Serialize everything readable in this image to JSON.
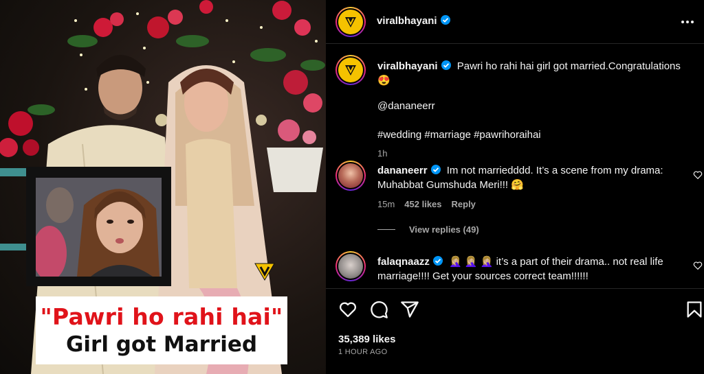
{
  "post": {
    "image_caption_line1": "\"Pawri ho rahi hai\"",
    "image_caption_line2": "Girl got Married"
  },
  "header": {
    "username": "viralbhayani",
    "more_icon": "more-horizontal-icon"
  },
  "caption": {
    "username": "viralbhayani",
    "text": "Pawri ho rahi hai girl got married.Congratulations 😍",
    "mention": "@dananeerr",
    "hashtags": "#wedding #marriage #pawrihoraihai",
    "time": "1h"
  },
  "comments": [
    {
      "username": "dananeerr",
      "text_line1": "Im not marriedddd. It’s a scene from my drama:",
      "text_line2": "Muhabbat Gumshuda Meri!!! 🤗",
      "time": "15m",
      "likes": "452 likes",
      "reply": "Reply",
      "view_replies": "View replies (49)"
    },
    {
      "username": "falaqnaazz",
      "text_line1": "🤦🏼‍♀️ 🤦🏼‍♀️ 🤦🏼‍♀️  it’s a part of their drama.. not real life",
      "text_line2": "marriage!!!! Get your sources correct team!!!!!!"
    }
  ],
  "actions": {
    "like_icon": "heart-icon",
    "comment_icon": "comment-icon",
    "share_icon": "send-icon",
    "save_icon": "bookmark-icon"
  },
  "likes": "35,389 likes",
  "posted": "1 HOUR AGO",
  "colors": {
    "verified": "#0095f6",
    "caption_red": "#e0131a",
    "brand_yellow": "#f5c200",
    "muted": "#a8a8a8"
  }
}
